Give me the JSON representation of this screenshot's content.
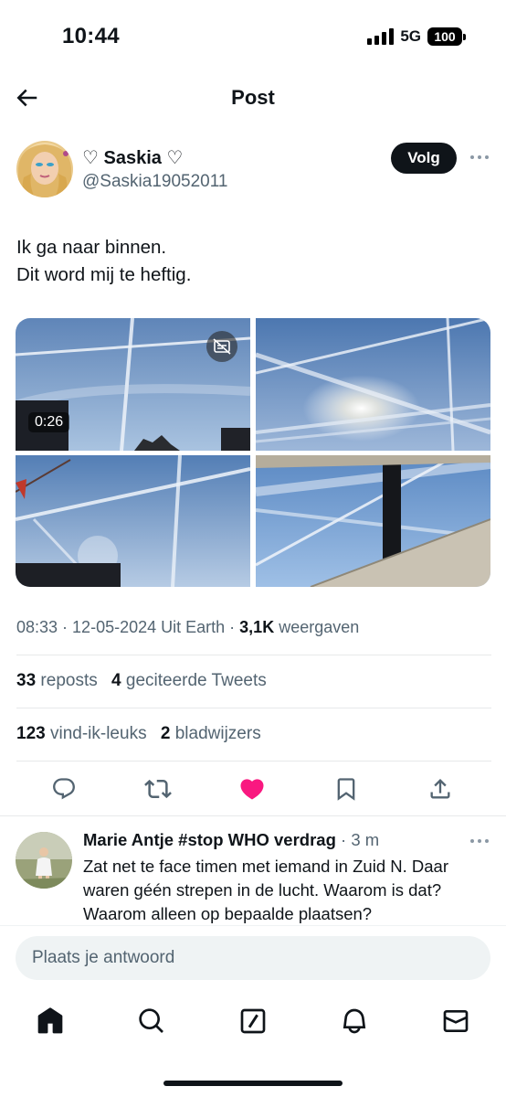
{
  "status_bar": {
    "time": "10:44",
    "network": "5G",
    "battery": "100"
  },
  "header": {
    "title": "Post",
    "back_icon": "arrow-left-icon"
  },
  "author": {
    "display_name": "♡ Saskia ♡",
    "handle": "@Saskia19052011",
    "follow_label": "Volg",
    "more_icon": "more-horizontal-icon"
  },
  "post": {
    "text_lines": [
      "Ik ga naar binnen.",
      "Dit word mij te heftig."
    ],
    "media": {
      "video_duration": "0:26",
      "caption_icon": "captions-off-icon"
    }
  },
  "meta": {
    "time": "08:33",
    "date": "12-05-2024",
    "source": "Uit Earth",
    "views_count": "3,1K",
    "views_label": "weergaven"
  },
  "stats": {
    "reposts_count": "33",
    "reposts_label": "reposts",
    "quotes_count": "4",
    "quotes_label": "geciteerde Tweets",
    "likes_count": "123",
    "likes_label": "vind-ik-leuks",
    "bookmarks_count": "2",
    "bookmarks_label": "bladwijzers"
  },
  "actions": {
    "icons": [
      "reply-icon",
      "repost-icon",
      "like-icon",
      "bookmark-icon",
      "share-icon"
    ],
    "like_color": "#f91880"
  },
  "reply": {
    "name": "Marie Antje #stop WHO verdrag",
    "time": "3 m",
    "text": "Zat net te face timen met iemand in Zuid N. Daar waren géén strepen in de lucht. Waarom is dat? Waarom alleen op bepaalde plaatsen?"
  },
  "composer": {
    "placeholder": "Plaats je antwoord"
  },
  "tab_bar": {
    "icons": [
      "home-icon",
      "search-icon",
      "communities-icon",
      "notifications-icon",
      "messages-icon"
    ]
  },
  "colors": {
    "text_primary": "#0f1419",
    "text_secondary": "#536471",
    "divider": "#e7e9ea"
  }
}
